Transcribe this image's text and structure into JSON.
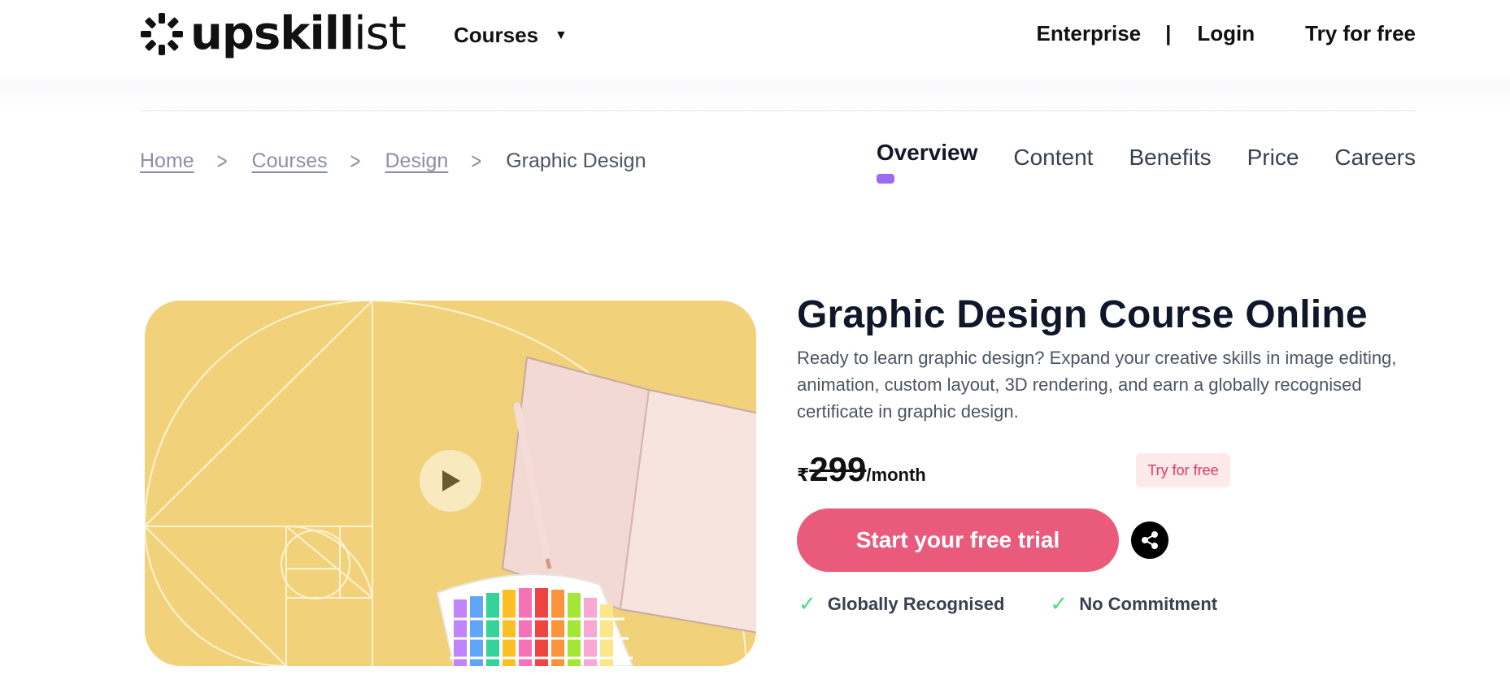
{
  "header": {
    "logo_bold": "upskill",
    "logo_light": "ist",
    "courses_label": "Courses",
    "enterprise_label": "Enterprise",
    "separator": "|",
    "login_label": "Login",
    "try_free_label": "Try for free"
  },
  "breadcrumb": {
    "items": [
      "Home",
      "Courses",
      "Design"
    ],
    "current": "Graphic Design"
  },
  "tabs": [
    {
      "label": "Overview",
      "active": true
    },
    {
      "label": "Content",
      "active": false
    },
    {
      "label": "Benefits",
      "active": false
    },
    {
      "label": "Price",
      "active": false
    },
    {
      "label": "Careers",
      "active": false
    }
  ],
  "course": {
    "title": "Graphic Design Course Online",
    "description": "Ready to learn graphic design? Expand your creative skills in image editing, animation, custom layout, 3D rendering, and earn a globally recognised certificate in graphic design.",
    "price_currency": "₹",
    "price_amount": "299",
    "price_period": "/month",
    "try_badge": "Try for free",
    "cta_label": "Start your free trial",
    "features": [
      "Globally Recognised",
      "No Commitment"
    ]
  },
  "colors": {
    "accent_purple": "#9b6cf0",
    "cta_pink": "#ea5a7a",
    "badge_bg": "#fde8ea",
    "badge_text": "#e23b5a",
    "hero_yellow": "#f1d27a",
    "check_green": "#4ade80"
  },
  "icons": {
    "logo": "upskillist-logo-icon",
    "caret": "caret-down-icon",
    "breadcrumb_sep": "chevron-right-icon",
    "play": "play-icon",
    "share": "share-icon",
    "check": "check-icon"
  }
}
